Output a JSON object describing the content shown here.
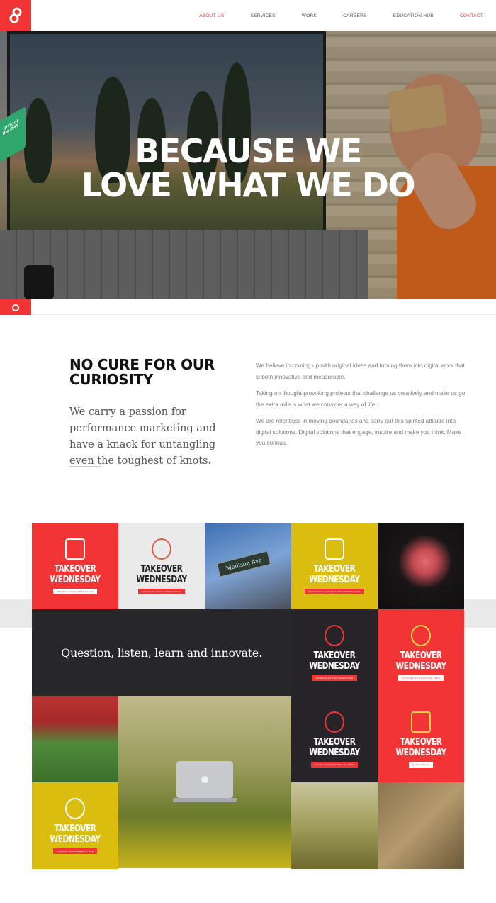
{
  "nav": {
    "items": [
      {
        "label": "ABOUT US",
        "active": true
      },
      {
        "label": "SERVICES",
        "active": false
      },
      {
        "label": "WORK",
        "active": false
      },
      {
        "label": "CAREERS",
        "active": false
      },
      {
        "label": "EDUCATION HUB",
        "active": false
      },
      {
        "label": "CONTACT",
        "active": false
      }
    ]
  },
  "hero": {
    "title_line1": "BECAUSE WE",
    "title_line2": "LOVE WHAT WE DO",
    "badge_line1": "SITE of",
    "badge_line2": "the DAY"
  },
  "intro": {
    "title": "NO CURE FOR OUR CURIOSITY",
    "lead": "We carry a passion for performance marketing and have a knack for untangling even the toughest of knots.",
    "paragraphs": [
      "We believe in coming up with original ideas and turning them into digital work that is both innovative and measurable.",
      "Taking on thought-provoking projects that challenge us creatively and make us go the extra mile is what we consider a way of life.",
      "We are relentless in moving boundaries and carry out this spirited attitude into digital solutions. Digital solutions that engage, inspire and make you think. Make you curious."
    ]
  },
  "grid": {
    "takeover_text": "TAKEOVER WEDNESDAY",
    "quote": "Question, listen, learn and innovate.",
    "street_sign": "Madison Ave",
    "tiles": [
      {
        "tag": "PROJECT MANAGEMENT TEAM"
      },
      {
        "tag": "FRONTEND DEVELOPMENT TEAM"
      },
      {
        "tag": "BACK-END & MOBILE DEVELOPMENT TEAM"
      },
      {
        "tag": "LEADERSHIP AND SALES TEAM"
      },
      {
        "tag": "ACCOUNTING & BALANCE TEAM"
      },
      {
        "tag": "SOCIAL MEDIA MARKETING TEAM"
      },
      {
        "tag": "DESIGN TEAM"
      },
      {
        "tag": "CONTENT MANAGEMENT TEAM"
      }
    ]
  },
  "colors": {
    "brand_red": "#f33434",
    "yellow": "#dbbd10",
    "dark": "#272629"
  }
}
